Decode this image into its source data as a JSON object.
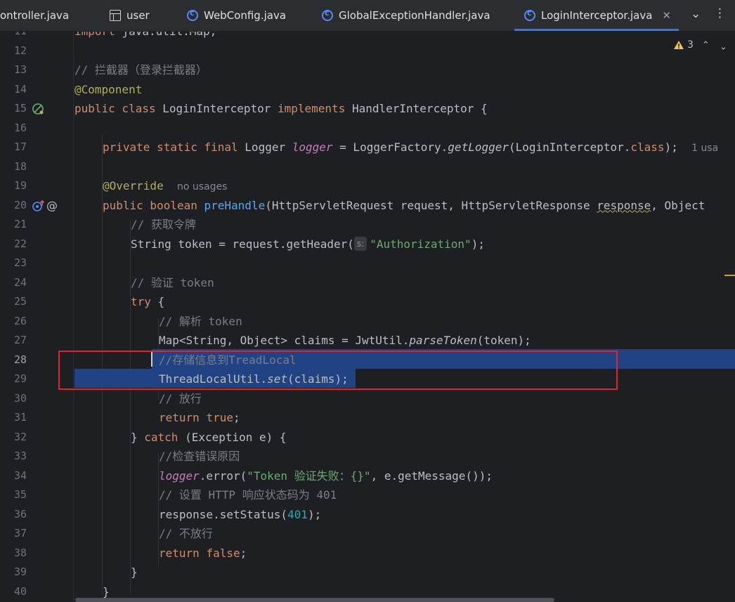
{
  "tabs": [
    {
      "label": "ontroller.java",
      "icon": "none"
    },
    {
      "label": "user",
      "icon": "table-icon"
    },
    {
      "label": "WebConfig.java",
      "icon": "class-icon"
    },
    {
      "label": "GlobalExceptionHandler.java",
      "icon": "class-icon"
    },
    {
      "label": "LoginInterceptor.java",
      "icon": "class-icon",
      "active": true
    }
  ],
  "warnings": {
    "count": "3"
  },
  "colors": {
    "selection": "#214283",
    "annotation_box": "#e0242a",
    "accent": "#3574f0"
  },
  "lines": {
    "l11": {
      "num": "11",
      "t1": "import ",
      "t2": "java.util.Map;"
    },
    "l12": {
      "num": "12"
    },
    "l13": {
      "num": "13",
      "t1": "// 拦截器（登录拦截器）"
    },
    "l14": {
      "num": "14",
      "t1": "@Component"
    },
    "l15": {
      "num": "15",
      "t1": "public class ",
      "t2": "LoginInterceptor ",
      "t3": "implements ",
      "t4": "HandlerInterceptor {"
    },
    "l16": {
      "num": "16"
    },
    "l17": {
      "num": "17",
      "t1": "private static final ",
      "t2": "Logger ",
      "t3": "logger",
      "t4": " = LoggerFactory.",
      "t5": "getLogger",
      "t6": "(LoginInterceptor.",
      "t7": "class",
      "t8": ");",
      "hint": "1 usa"
    },
    "l18": {
      "num": "18"
    },
    "l19": {
      "num": "19",
      "t1": "@Override",
      "hint": "no usages"
    },
    "l20": {
      "num": "20",
      "t1": "public boolean ",
      "t2": "preHandle",
      "t3": "(HttpServletRequest request, HttpServletResponse ",
      "t4": "response",
      "t5": ", Object"
    },
    "l21": {
      "num": "21",
      "t1": "// 获取令牌"
    },
    "l22": {
      "num": "22",
      "t1": "String token = request.getHeader(",
      "pin": "s:",
      "t2": "\"Authorization\"",
      "t3": ");"
    },
    "l23": {
      "num": "23"
    },
    "l24": {
      "num": "24",
      "t1": "// 验证 token"
    },
    "l25": {
      "num": "25",
      "t1": "try",
      "t2": " {"
    },
    "l26": {
      "num": "26",
      "t1": "// 解析 token"
    },
    "l27": {
      "num": "27",
      "t1": "Map<String, Object> claims = JwtUtil.",
      "t2": "parseToken",
      "t3": "(token);"
    },
    "l28": {
      "num": "28",
      "t1": "//存储信息到TreadLocal"
    },
    "l29": {
      "num": "29",
      "t1": "ThreadLocalUtil.",
      "t2": "set",
      "t3": "(claims);"
    },
    "l30": {
      "num": "30",
      "t1": "// 放行"
    },
    "l31": {
      "num": "31",
      "t1": "return ",
      "t2": "true",
      "t3": ";"
    },
    "l32": {
      "num": "32",
      "t1": "} ",
      "t2": "catch",
      "t3": " (Exception e) {"
    },
    "l33": {
      "num": "33",
      "t1": "//检查错误原因"
    },
    "l34": {
      "num": "34",
      "t1": "logger",
      "t2": ".error(",
      "t3": "\"Token 验证失败：{}\"",
      "t4": ", e.getMessage());"
    },
    "l35": {
      "num": "35",
      "t1": "// 设置 HTTP 响应状态码为 401"
    },
    "l36": {
      "num": "36",
      "t1": "response.setStatus(",
      "t2": "401",
      "t3": ");"
    },
    "l37": {
      "num": "37",
      "t1": "// 不放行"
    },
    "l38": {
      "num": "38",
      "t1": "return ",
      "t2": "false",
      "t3": ";"
    },
    "l39": {
      "num": "39",
      "t1": "}"
    },
    "l40": {
      "num": "40",
      "t1": "}"
    }
  }
}
